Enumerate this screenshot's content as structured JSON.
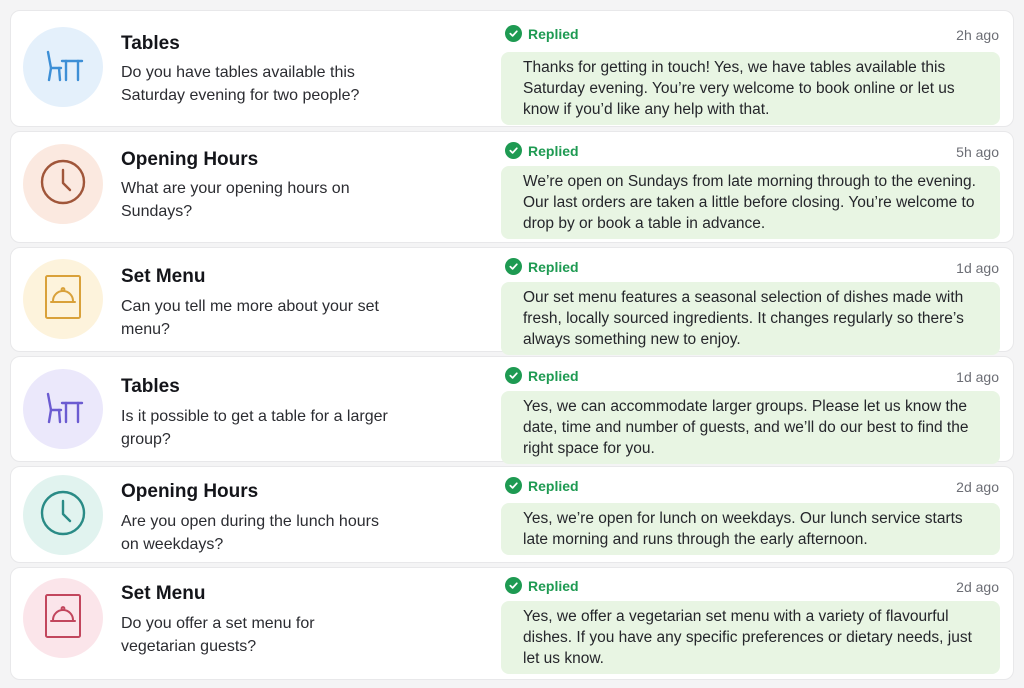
{
  "status_color": "#1e9a52",
  "reply_bg": "#e8f5e3",
  "messages": [
    {
      "category": "Tables",
      "icon": "table-chair-icon",
      "avatar_bg": "#e4f0fb",
      "icon_color": "#3d8fd6",
      "question": "Do you have tables available this Saturday evening for two people?",
      "status": "Replied",
      "time": "2h ago",
      "reply": "Thanks for getting in touch! Yes, we have tables available this Saturday evening. You’re very welcome to book online or let us know if you’d like any help with that."
    },
    {
      "category": "Opening Hours",
      "icon": "clock-icon",
      "avatar_bg": "#fbe9e0",
      "icon_color": "#a0563a",
      "question": "What are your opening hours on Sundays?",
      "status": "Replied",
      "time": "5h ago",
      "reply": "We’re open on Sundays from late morning through to the evening. Our last orders are taken a little before closing. You’re welcome to drop by or book a table in advance."
    },
    {
      "category": "Set Menu",
      "icon": "menu-cloche-icon",
      "avatar_bg": "#fdf3dc",
      "icon_color": "#d9a13a",
      "question": "Can you tell me more about your set menu?",
      "status": "Replied",
      "time": "1d ago",
      "reply": "Our set menu features a seasonal selection of dishes made with fresh, locally sourced ingredients. It changes regularly so there’s always something new to enjoy."
    },
    {
      "category": "Tables",
      "icon": "table-chair-icon",
      "avatar_bg": "#ebe8fb",
      "icon_color": "#6b5bd1",
      "question": "Is it possible to get a table for a larger group?",
      "status": "Replied",
      "time": "1d ago",
      "reply": "Yes, we can accommodate larger groups. Please let us know the date, time and number of guests, and we’ll do our best to find the right space for you."
    },
    {
      "category": "Opening Hours",
      "icon": "clock-icon",
      "avatar_bg": "#e1f3ef",
      "icon_color": "#2a8b86",
      "question": "Are you open during the lunch hours on weekdays?",
      "status": "Replied",
      "time": "2d ago",
      "reply": "Yes, we’re open for lunch on weekdays. Our lunch service starts late morning and runs through the early afternoon."
    },
    {
      "category": "Set Menu",
      "icon": "menu-cloche-icon",
      "avatar_bg": "#fbe5ea",
      "icon_color": "#c2465d",
      "question": "Do you offer a set menu for vegetarian guests?",
      "status": "Replied",
      "time": "2d ago",
      "reply": "Yes, we offer a vegetarian set menu with a variety of flavourful dishes. If you have any specific preferences or dietary needs, just let us know."
    }
  ]
}
